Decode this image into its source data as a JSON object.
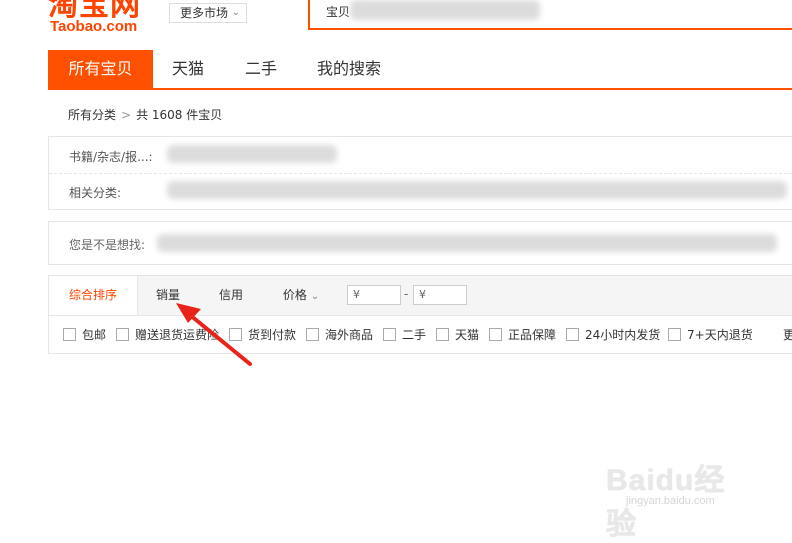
{
  "header": {
    "logo_cn": "淘宝网",
    "logo_en": "Taobao.com",
    "market_label": "更多市场",
    "search_scope": "宝贝"
  },
  "tabs": [
    {
      "label": "所有宝贝",
      "active": true
    },
    {
      "label": "天猫",
      "active": false
    },
    {
      "label": "二手",
      "active": false
    },
    {
      "label": "我的搜索",
      "active": false
    }
  ],
  "breadcrumb": {
    "root": "所有分类",
    "count_text": "共 1608 件宝贝"
  },
  "filters": {
    "category_label": "书籍/杂志/报...:",
    "related_label": "相关分类:"
  },
  "suggest": {
    "label": "您是不是想找:"
  },
  "sort": {
    "items": [
      {
        "label": "综合排序",
        "active": true
      },
      {
        "label": "销量",
        "active": false
      },
      {
        "label": "信用",
        "active": false
      },
      {
        "label": "价格",
        "active": false
      }
    ],
    "price_min_placeholder": "¥",
    "price_max_placeholder": "¥",
    "price_sep": "-"
  },
  "checkboxes": [
    {
      "label": "包邮",
      "checked": false
    },
    {
      "label": "赠送退货运费险",
      "checked": false
    },
    {
      "label": "货到付款",
      "checked": false
    },
    {
      "label": "海外商品",
      "checked": false
    },
    {
      "label": "二手",
      "checked": false
    },
    {
      "label": "天猫",
      "checked": false
    },
    {
      "label": "正品保障",
      "checked": false
    },
    {
      "label": "24小时内发货",
      "checked": false
    },
    {
      "label": "7+天内退货",
      "checked": false
    }
  ],
  "more_label": "更",
  "watermark": {
    "main": "Baidu经验",
    "sub": "jingyan.baidu.com"
  },
  "colors": {
    "brand": "#ff5000",
    "annotation_arrow": "#e8241a"
  }
}
